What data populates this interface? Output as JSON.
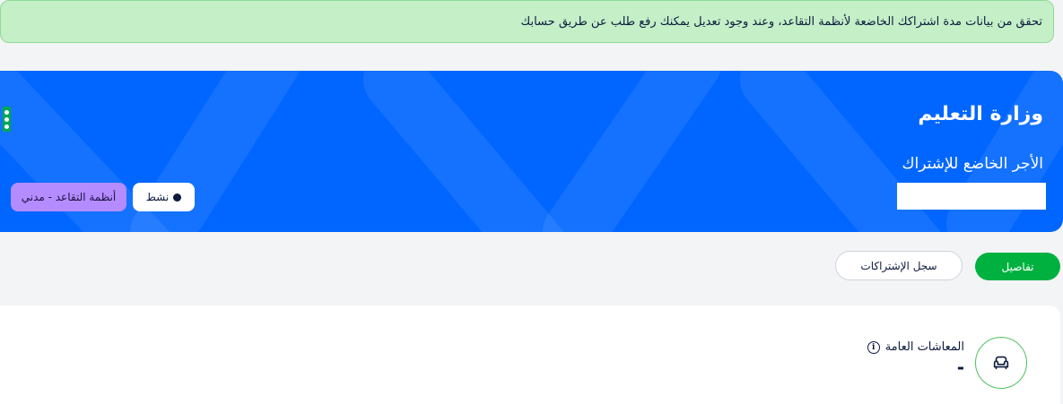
{
  "alert": {
    "text": "تحقق من بيانات مدة اشتراكك الخاضعة لأنظمة التقاعد، وعند وجود تعديل يمكنك رفع طلب عن طريق حسابك"
  },
  "hero": {
    "title": "وزارة التعليم",
    "subtitle": "الأجر الخاضع للإشتراك",
    "value": "",
    "status_label": "نشط",
    "type_label": "أنظمة التقاعد - مدني",
    "menu_icon": "kebab-menu-icon",
    "colors": {
      "background": "#0066ff",
      "type_pill": "#b48cff"
    }
  },
  "tabs": [
    {
      "label": "تفاصيل",
      "active": true
    },
    {
      "label": "سجل الإشتراكات",
      "active": false
    }
  ],
  "card": {
    "icon": "armchair-icon",
    "label": "المعاشات العامة",
    "info_icon": "info-icon",
    "value": "-"
  },
  "colors": {
    "alert_bg": "#c4efc7",
    "accent_green": "#00b140"
  }
}
